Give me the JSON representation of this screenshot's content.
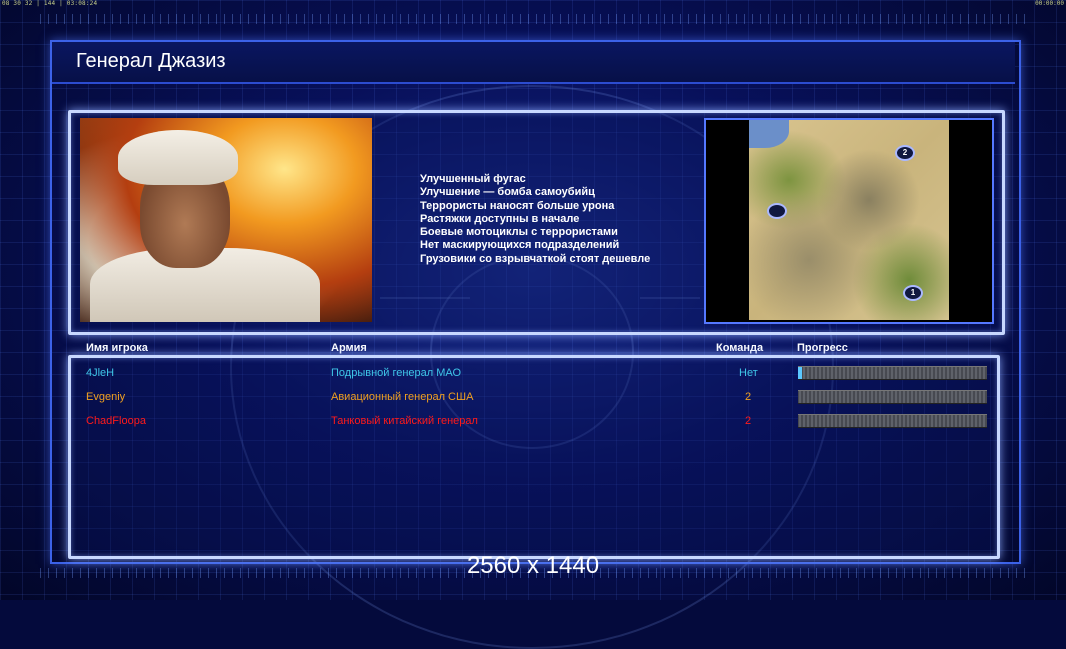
{
  "status_bar": {
    "left": "08 30 32 | 144 | 03:08:24",
    "right": "00:00:00"
  },
  "title": "Генерал Джазиз",
  "general": {
    "bonuses": [
      "Улучшенный фугас",
      "Улучшение — бомба самоубийц",
      "Террористы наносят больше урона",
      "Растяжки доступны в начале",
      "Боевые мотоциклы с террористами",
      "Нет маскирующихся подразделений",
      "Грузовики со взрывчаткой стоят дешевле"
    ]
  },
  "map": {
    "markers": [
      {
        "label": "2",
        "name": "map-start-marker-2"
      },
      {
        "label": "",
        "name": "map-start-marker-selected"
      },
      {
        "label": "1",
        "name": "map-start-marker-1"
      }
    ]
  },
  "table": {
    "headers": {
      "player": "Имя игрока",
      "army": "Армия",
      "team": "Команда",
      "progress": "Прогресс"
    },
    "rows": [
      {
        "player": "4JleH",
        "army": "Подрывной генерал МАО",
        "team": "Нет",
        "progress": 0.01,
        "color": "#3fc6e8"
      },
      {
        "player": "Evgeniy",
        "army": "Авиационный генерал США",
        "team": "2",
        "progress": 0,
        "color": "#f0a020"
      },
      {
        "player": "ChadFloopa",
        "army": "Танковый китайский генерал",
        "team": "2",
        "progress": 0,
        "color": "#ff1a1a"
      }
    ]
  },
  "resolution_label": "2560 x 1440"
}
